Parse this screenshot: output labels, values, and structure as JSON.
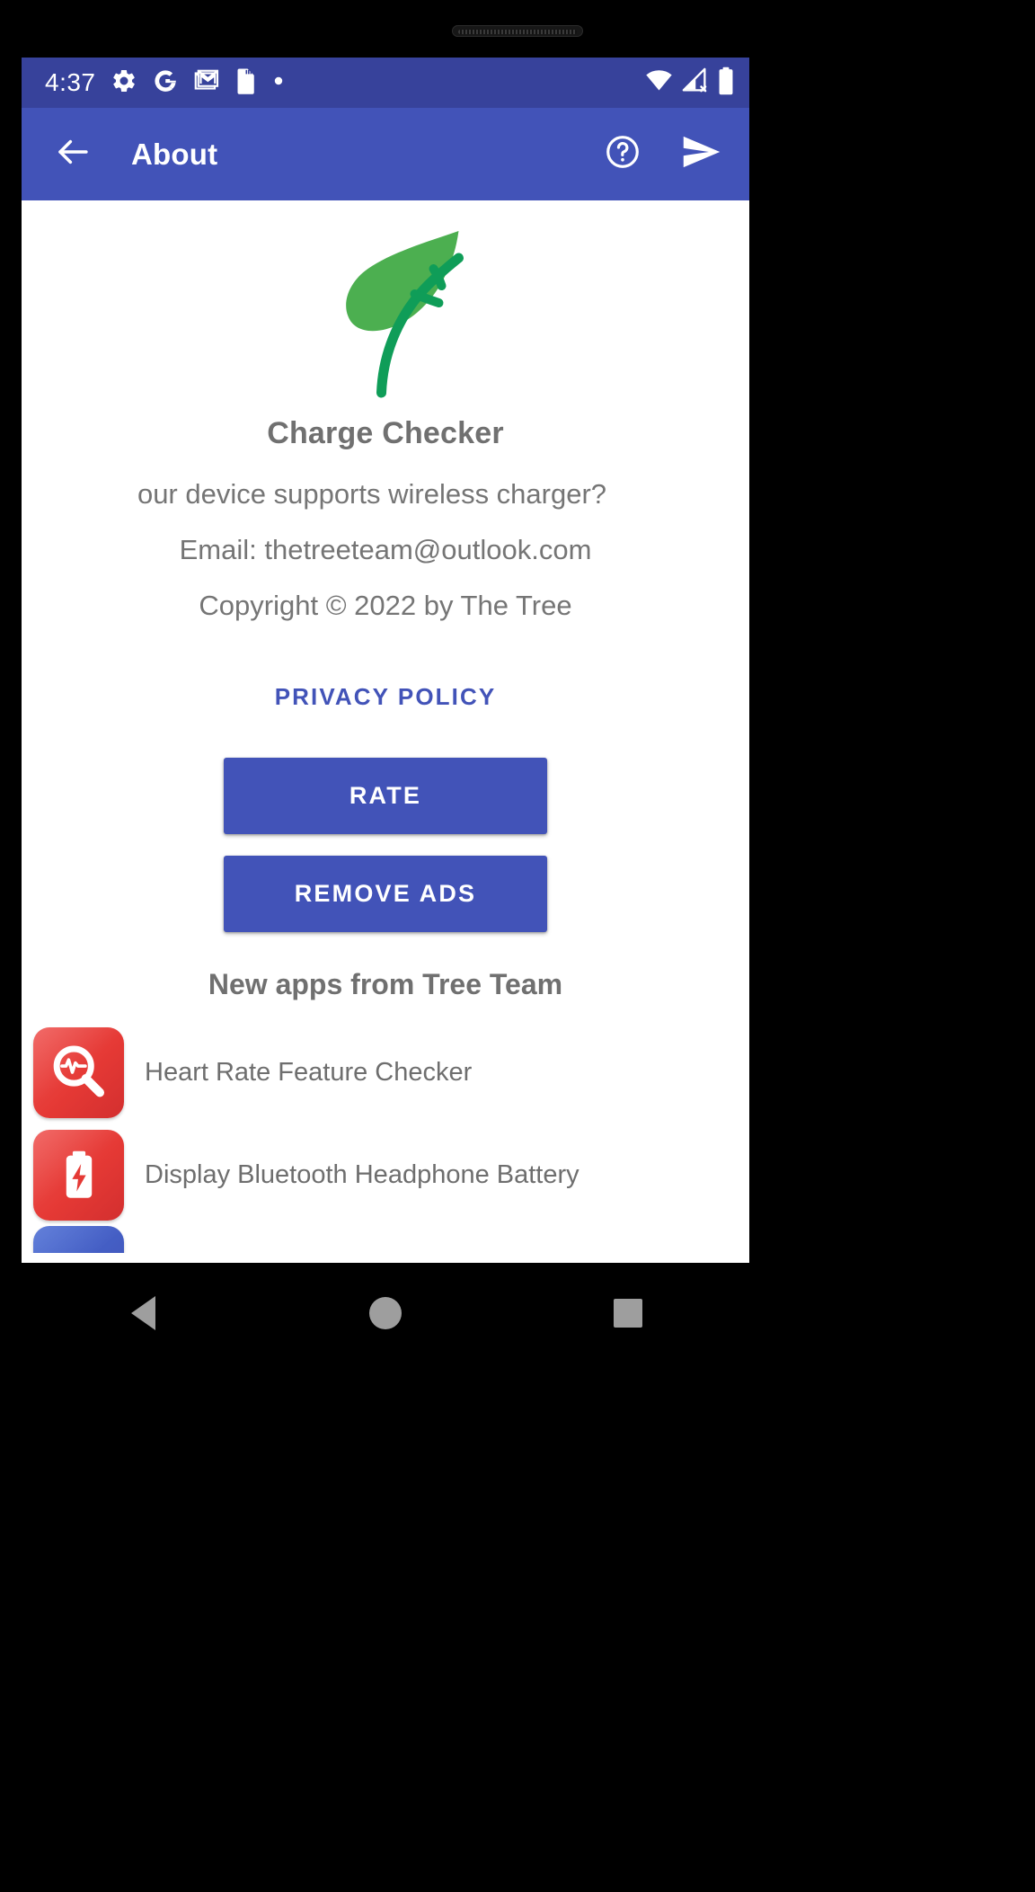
{
  "status_bar": {
    "time": "4:37",
    "left_icons": [
      "gear-icon",
      "google-icon",
      "gmail-icon",
      "sd-card-icon",
      "dot-icon"
    ],
    "right_icons": [
      "wifi-icon",
      "cell-signal-off-icon",
      "battery-full-icon"
    ],
    "background_color": "#37429b"
  },
  "app_bar": {
    "back_label": "Back",
    "title": "About",
    "help_label": "Help",
    "share_label": "Share",
    "background_color": "#4253b8"
  },
  "about": {
    "logo": "green-leaf-logo",
    "app_name": "Charge Checker",
    "description": "our device supports wireless charger?",
    "email_line": "Email: thetreeteam@outlook.com",
    "copyright_line": "Copyright © 2022 by The Tree",
    "privacy_policy_label": "PRIVACY POLICY",
    "privacy_policy_color": "#4253b8",
    "rate_label": "RATE",
    "remove_ads_label": "REMOVE ADS",
    "button_color": "#4253b8",
    "title_color": "#707070",
    "text_color": "#757575"
  },
  "new_apps": {
    "heading": "New apps from Tree Team",
    "items": [
      {
        "icon": "heart-rate-magnifier-icon",
        "icon_color": "#e53935",
        "label": "Heart Rate Feature Checker"
      },
      {
        "icon": "battery-bolt-icon",
        "icon_color": "#e53935",
        "label": "Display Bluetooth Headphone Battery"
      },
      {
        "icon": "blue-app-icon",
        "icon_color": "#3f51b5",
        "label": ""
      }
    ]
  },
  "nav_bar": {
    "back_label": "Back",
    "home_label": "Home",
    "recents_label": "Recent apps"
  }
}
